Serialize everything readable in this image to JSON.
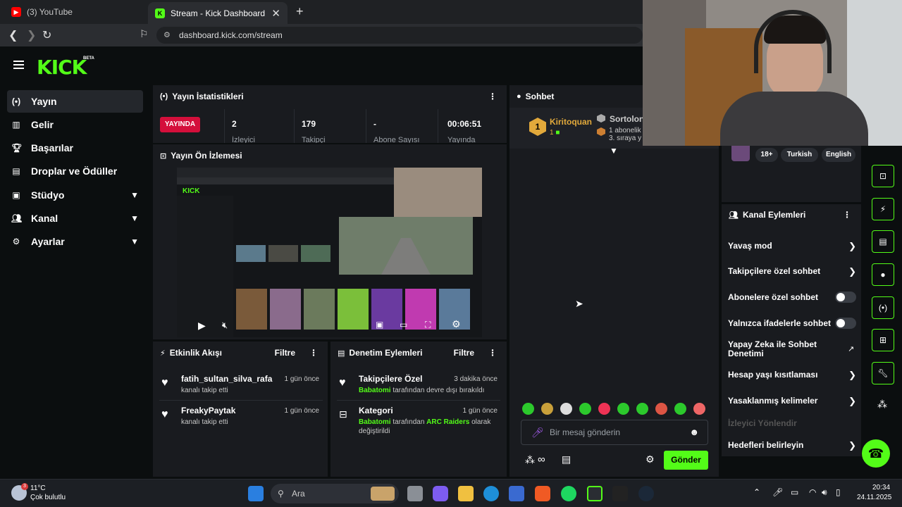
{
  "browser": {
    "tabs": [
      {
        "label": "(3) YouTube"
      },
      {
        "label": "Stream - Kick Dashboard"
      }
    ],
    "new_tab": "+",
    "close": "✕",
    "url": "dashboard.kick.com/stream"
  },
  "header": {
    "logo": "KICK",
    "badge": "BETA"
  },
  "sidebar": {
    "items": [
      {
        "label": "Yayın",
        "icon": "broadcast-icon"
      },
      {
        "label": "Gelir",
        "icon": "chart-icon"
      },
      {
        "label": "Başarılar",
        "icon": "trophy-icon"
      },
      {
        "label": "Droplar ve Ödüller",
        "icon": "gift-icon"
      },
      {
        "label": "Stüdyo",
        "icon": "camera-icon"
      },
      {
        "label": "Kanal",
        "icon": "users-icon"
      },
      {
        "label": "Ayarlar",
        "icon": "gear-icon"
      }
    ]
  },
  "stats_panel": {
    "title": "Yayın İstatistikleri",
    "live_badge": "YAYINDA",
    "stats": [
      {
        "value": "2",
        "label": "İzleyici"
      },
      {
        "value": "179",
        "label": "Takipçi"
      },
      {
        "value": "-",
        "label": "Abone Sayısı"
      },
      {
        "value": "00:06:51",
        "label": "Yayında"
      }
    ]
  },
  "preview_panel": {
    "title": "Yayın Ön İzlemesi"
  },
  "activity_panel": {
    "title": "Etkinlik Akışı",
    "filter": "Filtre",
    "items": [
      {
        "name": "fatih_sultan_silva_rafa",
        "sub": "kanalı takip etti",
        "time": "1 gün önce"
      },
      {
        "name": "FreakyPaytak",
        "sub": "kanalı takip etti",
        "time": "1 gün önce"
      }
    ]
  },
  "moderation_panel": {
    "title": "Denetim Eylemleri",
    "filter": "Filtre",
    "items": [
      {
        "name": "Takipçilere Özel",
        "user": "Babatomi",
        "sub": "tarafından devre dışı bırakıldı",
        "time": "3 dakika önce"
      },
      {
        "name": "Kategori",
        "user": "Babatomi",
        "sub1": "tarafından",
        "category": "ARC Raiders",
        "sub2": "olarak",
        "sub3": "değiştirildi",
        "time": "1 gün önce"
      }
    ]
  },
  "chat": {
    "title": "Sohbet",
    "leader_rank": "1",
    "leader_name": "Kiritoquan",
    "leader_count": "1",
    "second_name": "Sortolon",
    "second_sub": "1 abonelik",
    "second_rank": "3. sıraya y",
    "placeholder": "Bir mesaj gönderin",
    "send": "Gönder"
  },
  "channel_info": {
    "tags": [
      "18+",
      "Turkish",
      "English"
    ]
  },
  "channel_actions": {
    "title": "Kanal Eylemleri",
    "rows": [
      {
        "label": "Yavaş mod"
      },
      {
        "label": "Takipçilere özel sohbet"
      },
      {
        "label": "Abonelere özel sohbet"
      },
      {
        "label": "Yalnızca ifadelerle sohbet"
      },
      {
        "label": "Yapay Zeka ile Sohbet Denetimi"
      },
      {
        "label": "Hesap yaşı kısıtlaması"
      },
      {
        "label": "Yasaklanmış kelimeler"
      },
      {
        "label": "İzleyici Yönlendir"
      },
      {
        "label": "Hedefleri belirleyin"
      }
    ]
  },
  "taskbar": {
    "weather_temp": "11°C",
    "weather_desc": "Çok bulutlu",
    "weather_badge": "3",
    "search": "Ara",
    "time": "20:34",
    "date": "24.11.2025"
  },
  "colors": {
    "accent": "#53fc18",
    "live": "#d40f3b",
    "panel": "#191b1f",
    "bg": "#0b0e0f"
  }
}
